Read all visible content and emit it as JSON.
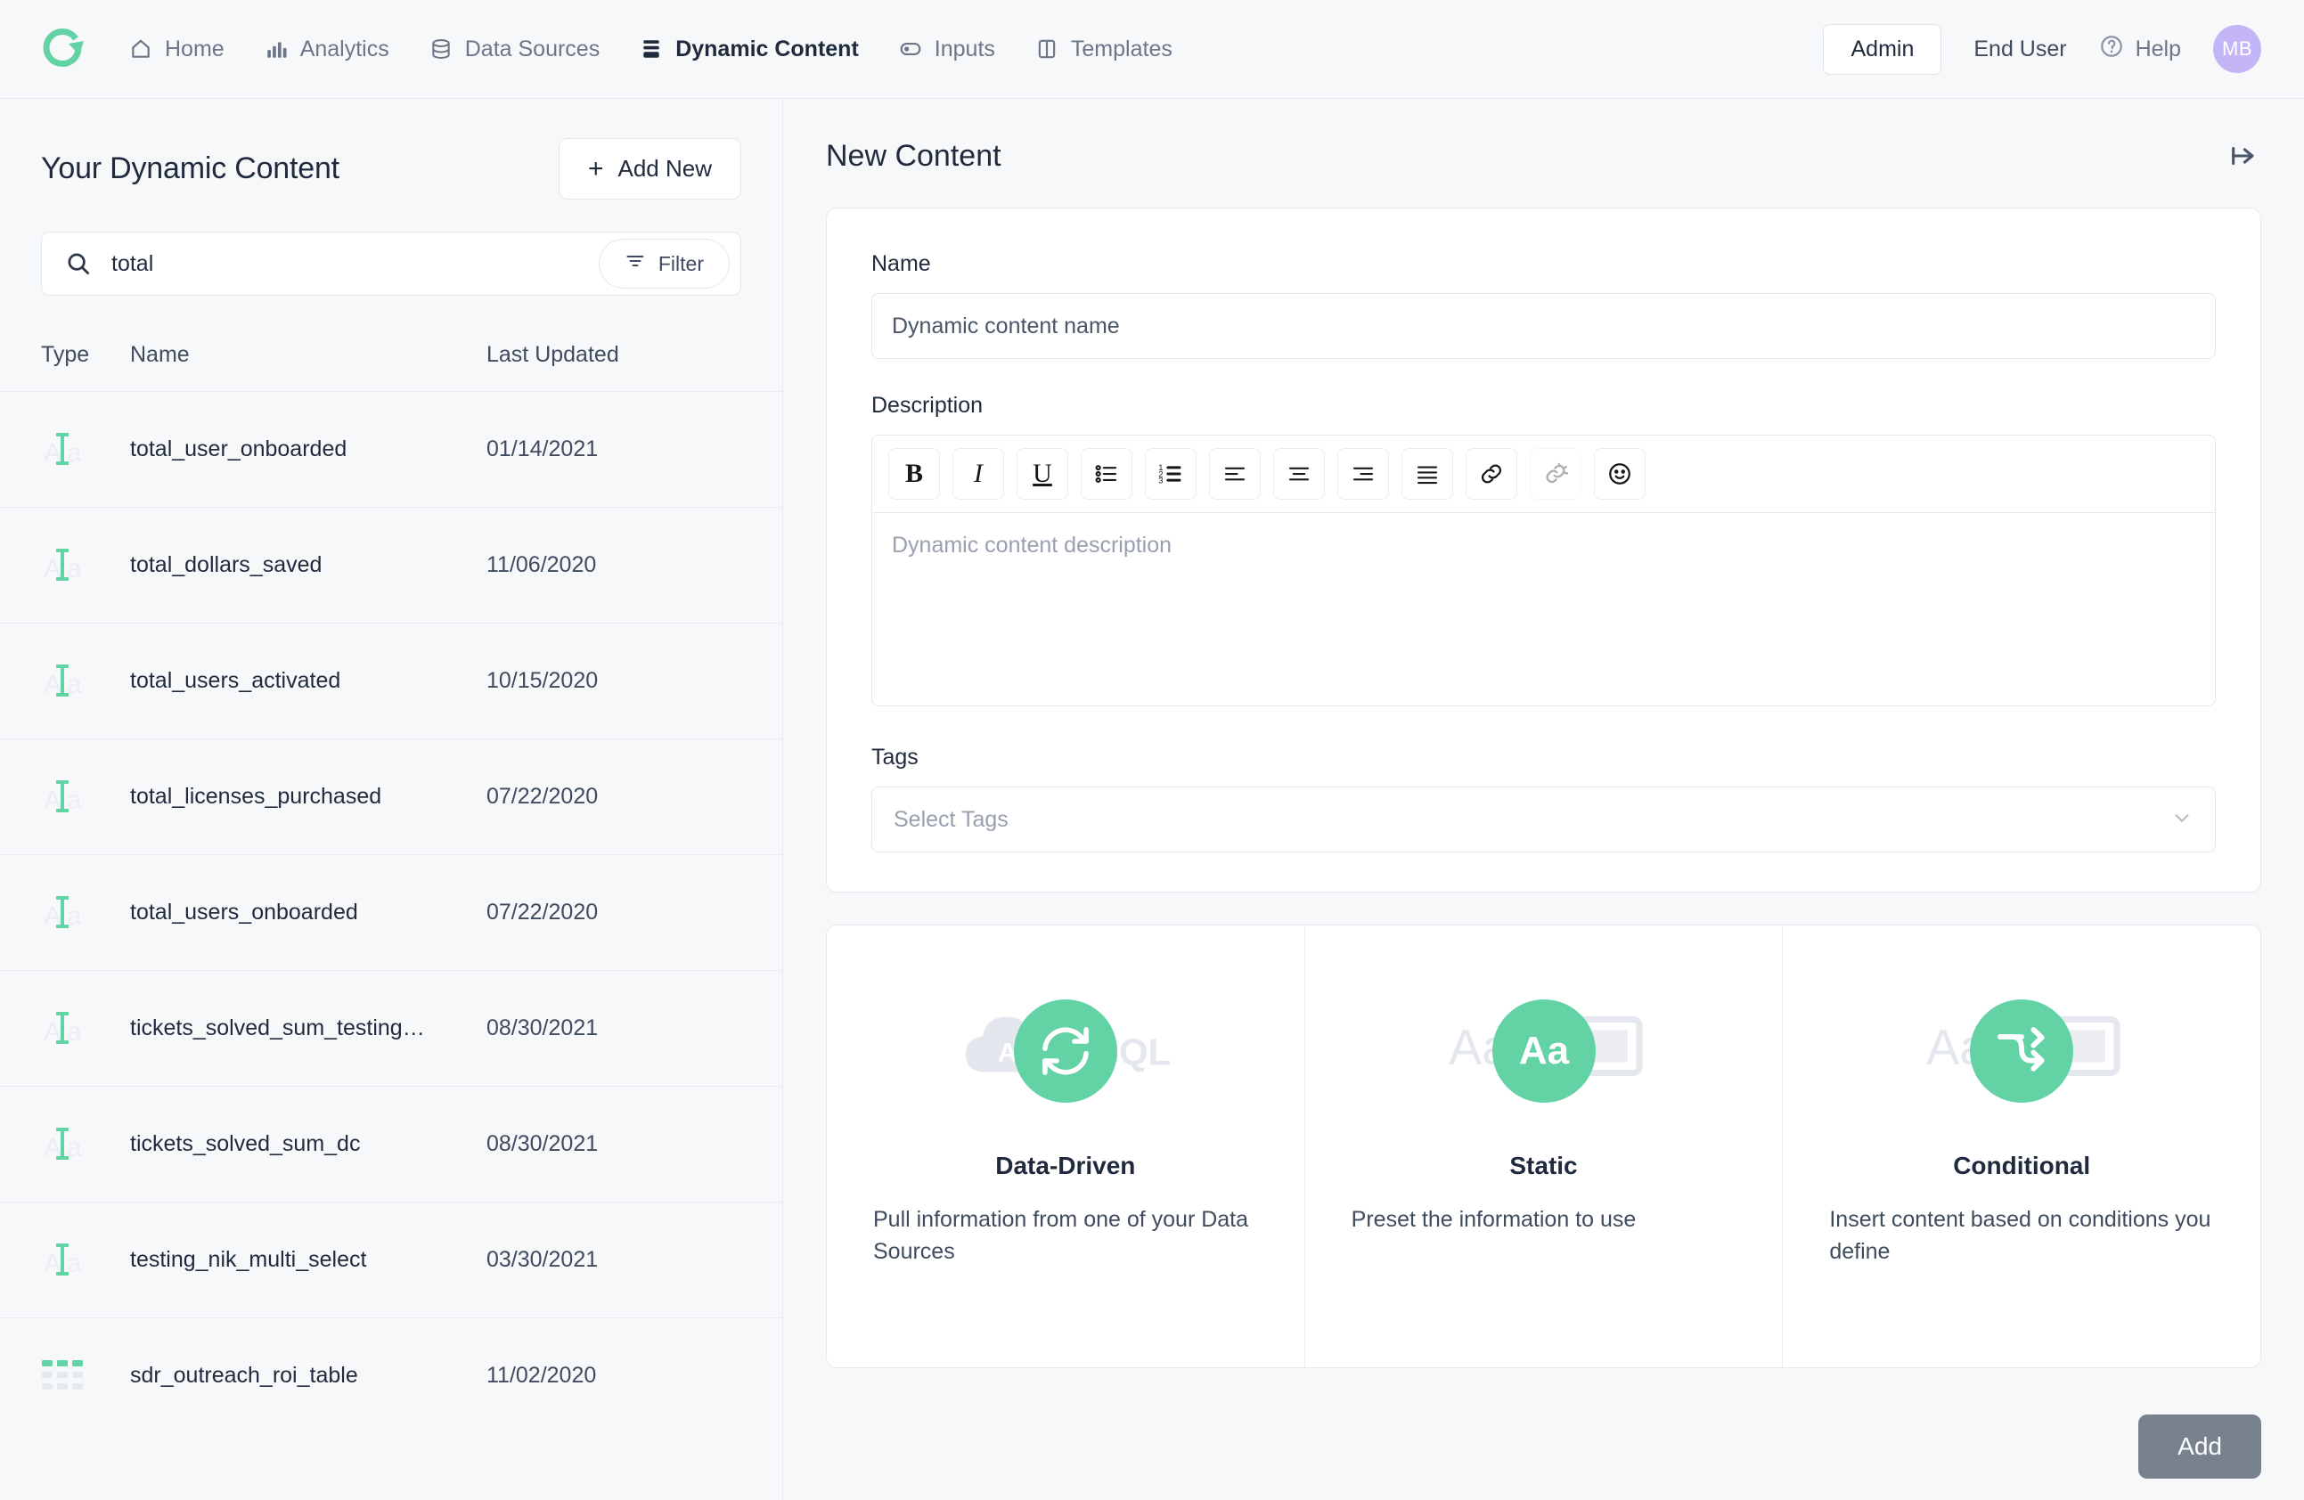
{
  "brand": {
    "logo_icon": "refresh-logo-icon",
    "accent": "#63d3a6"
  },
  "topnav": {
    "items": [
      {
        "label": "Home",
        "icon": "home-icon",
        "active": false
      },
      {
        "label": "Analytics",
        "icon": "bar-chart-icon",
        "active": false
      },
      {
        "label": "Data Sources",
        "icon": "database-icon",
        "active": false
      },
      {
        "label": "Dynamic Content",
        "icon": "layers-icon",
        "active": true
      },
      {
        "label": "Inputs",
        "icon": "toggle-icon",
        "active": false
      },
      {
        "label": "Templates",
        "icon": "columns-icon",
        "active": false
      }
    ],
    "admin_label": "Admin",
    "end_user_label": "End User",
    "help_label": "Help",
    "help_icon": "question-circle-icon",
    "avatar_initials": "MB",
    "avatar_color": "#c4b5f7"
  },
  "sidebar": {
    "title": "Your Dynamic Content",
    "add_new_label": "Add New",
    "add_new_icon": "plus-icon",
    "search": {
      "value": "total",
      "placeholder": "Search",
      "icon": "search-icon"
    },
    "filter_label": "Filter",
    "filter_icon": "filter-icon",
    "columns": {
      "type": "Type",
      "name": "Name",
      "last_updated": "Last Updated"
    },
    "rows": [
      {
        "type_icon": "static-text-icon",
        "name": "total_user_onboarded",
        "date": "01/14/2021"
      },
      {
        "type_icon": "static-text-icon",
        "name": "total_dollars_saved",
        "date": "11/06/2020"
      },
      {
        "type_icon": "static-text-icon",
        "name": "total_users_activated",
        "date": "10/15/2020"
      },
      {
        "type_icon": "static-text-icon",
        "name": "total_licenses_purchased",
        "date": "07/22/2020"
      },
      {
        "type_icon": "static-text-icon",
        "name": "total_users_onboarded",
        "date": "07/22/2020"
      },
      {
        "type_icon": "static-text-icon",
        "name": "tickets_solved_sum_testing…",
        "date": "08/30/2021"
      },
      {
        "type_icon": "static-text-icon",
        "name": "tickets_solved_sum_dc",
        "date": "08/30/2021"
      },
      {
        "type_icon": "static-text-icon",
        "name": "testing_nik_multi_select",
        "date": "03/30/2021"
      },
      {
        "type_icon": "table-icon",
        "name": "sdr_outreach_roi_table",
        "date": "11/02/2020"
      }
    ]
  },
  "detail": {
    "title": "New Content",
    "collapse_icon": "arrow-to-right-icon",
    "name_label": "Name",
    "name_placeholder": "Dynamic content name",
    "name_value": "",
    "description_label": "Description",
    "description_placeholder": "Dynamic content description",
    "description_value": "",
    "toolbar": [
      {
        "icon": "bold-icon",
        "label": "B",
        "disabled": false
      },
      {
        "icon": "italic-icon",
        "label": "I",
        "disabled": false
      },
      {
        "icon": "underline-icon",
        "label": "U",
        "disabled": false
      },
      {
        "icon": "bullet-list-icon",
        "label": "",
        "disabled": false
      },
      {
        "icon": "numbered-list-icon",
        "label": "",
        "disabled": false
      },
      {
        "icon": "align-left-icon",
        "label": "",
        "disabled": false
      },
      {
        "icon": "align-center-icon",
        "label": "",
        "disabled": false
      },
      {
        "icon": "align-right-icon",
        "label": "",
        "disabled": false
      },
      {
        "icon": "align-justify-icon",
        "label": "",
        "disabled": false
      },
      {
        "icon": "link-icon",
        "label": "",
        "disabled": false
      },
      {
        "icon": "unlink-icon",
        "label": "",
        "disabled": true
      },
      {
        "icon": "emoji-icon",
        "label": "",
        "disabled": false
      }
    ],
    "tags_label": "Tags",
    "tags_placeholder": "Select Tags",
    "tags_chevron_icon": "chevron-down-icon",
    "type_cards": [
      {
        "title": "Data-Driven",
        "desc": "Pull information from one of your Data Sources",
        "icon": "sync-arrows-icon",
        "ghost": "api-sql-cloud-icon"
      },
      {
        "title": "Static",
        "desc": "Preset the information to use",
        "icon": "aa-text-icon",
        "ghost": "text-field-icon"
      },
      {
        "title": "Conditional",
        "desc": "Insert content based on conditions you define",
        "icon": "branch-arrows-icon",
        "ghost": "text-field-icon"
      }
    ],
    "add_label": "Add"
  }
}
